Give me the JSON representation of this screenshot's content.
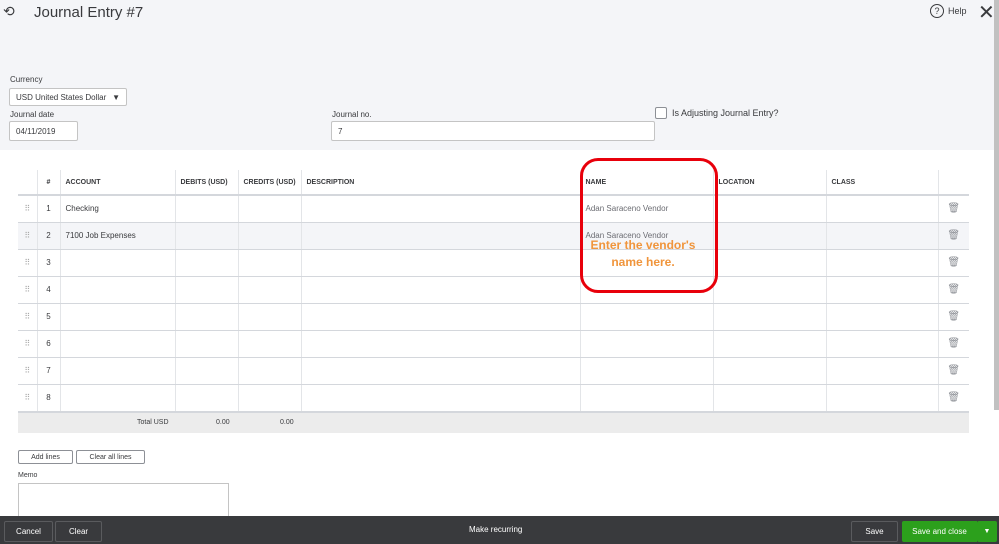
{
  "header": {
    "title": "Journal Entry #7",
    "help": "Help"
  },
  "form": {
    "currency_label": "Currency",
    "currency_value": "USD United States Dollar",
    "date_label": "Journal date",
    "date_value": "04/11/2019",
    "no_label": "Journal no.",
    "no_value": "7",
    "adjusting_label": "Is Adjusting Journal Entry?"
  },
  "table": {
    "columns": [
      "#",
      "ACCOUNT",
      "DEBITS (USD)",
      "CREDITS (USD)",
      "DESCRIPTION",
      "NAME",
      "LOCATION",
      "CLASS"
    ],
    "rows": [
      {
        "n": "1",
        "account": "Checking",
        "name": "Adan Saraceno Vendor"
      },
      {
        "n": "2",
        "account": "7100 Job Expenses",
        "name": "Adan Saraceno Vendor"
      },
      {
        "n": "3"
      },
      {
        "n": "4"
      },
      {
        "n": "5"
      },
      {
        "n": "6"
      },
      {
        "n": "7"
      },
      {
        "n": "8"
      }
    ],
    "total_label": "Total USD",
    "total_debits": "0.00",
    "total_credits": "0.00"
  },
  "actions": {
    "add_lines": "Add lines",
    "clear_all": "Clear all lines",
    "memo_label": "Memo"
  },
  "footer": {
    "cancel": "Cancel",
    "clear": "Clear",
    "recurring": "Make recurring",
    "save": "Save",
    "save_close": "Save and close"
  },
  "annotation": {
    "text": "Enter the vendor's name here."
  },
  "colors": {
    "accent": "#2ca01c",
    "callout": "#e8000b",
    "callout_text": "#f0953c"
  }
}
